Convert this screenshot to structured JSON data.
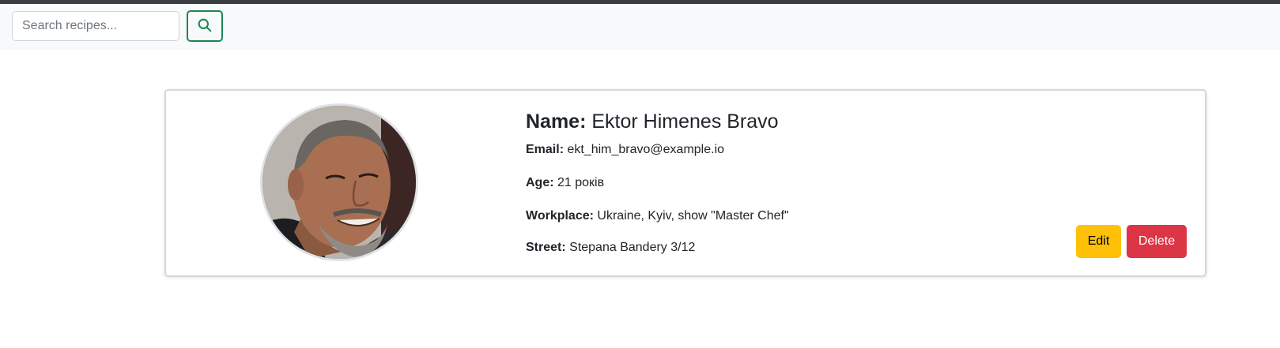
{
  "search": {
    "placeholder": "Search recipes...",
    "button_icon": "search-icon",
    "accent_color": "#198754"
  },
  "profile": {
    "name_label": "Name:",
    "name": "Ektor Himenes Bravo",
    "email_label": "Email:",
    "email": "ekt_him_bravo@example.io",
    "age_label": "Age:",
    "age": "21 років",
    "workplace_label": "Workplace:",
    "workplace": "Ukraine, Kyiv, show \"Master Chef\"",
    "street_label": "Street:",
    "street": "Stepana Bandery 3/12"
  },
  "actions": {
    "edit_label": "Edit",
    "edit_color": "#ffc107",
    "delete_label": "Delete",
    "delete_color": "#dc3545"
  }
}
